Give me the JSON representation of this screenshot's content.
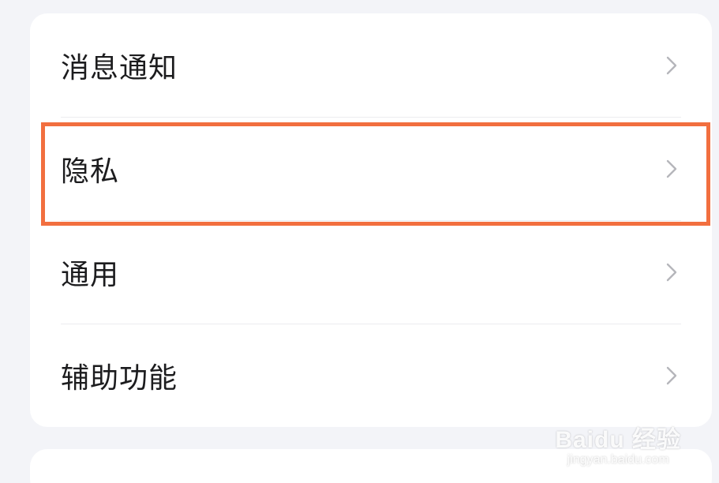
{
  "settings": {
    "items": [
      {
        "label": "消息通知",
        "icon": "chevron-right-icon"
      },
      {
        "label": "隐私",
        "icon": "chevron-right-icon"
      },
      {
        "label": "通用",
        "icon": "chevron-right-icon"
      },
      {
        "label": "辅助功能",
        "icon": "chevron-right-icon"
      }
    ],
    "highlighted_item": "隐私"
  },
  "colors": {
    "background": "#f3f4f8",
    "card": "#ffffff",
    "text": "#1c1c1e",
    "chevron": "#b5b6bb",
    "divider": "#ececef",
    "highlight": "#f26f3f"
  },
  "watermark": {
    "brand": "Baidu 经验",
    "url": "jingyan.baidu.com"
  }
}
